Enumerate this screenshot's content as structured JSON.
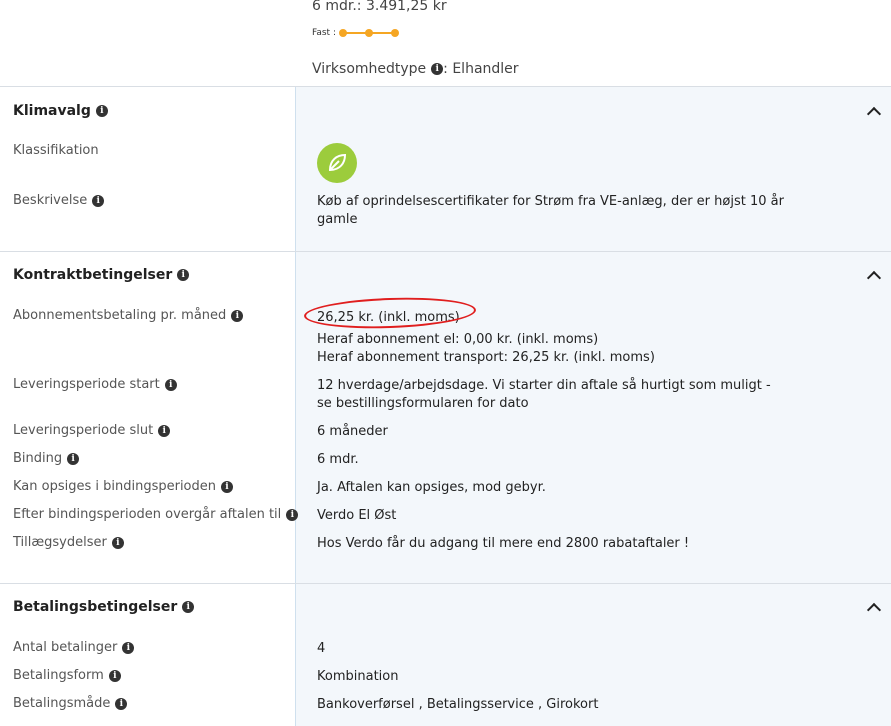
{
  "summary": {
    "price_line": "6 mdr.: 3.491,25 kr",
    "fast_label": "Fast :",
    "business_type_label": "Virksomhedtype",
    "business_type_value": ": Elhandler"
  },
  "sections": {
    "klima": {
      "title": "Klimavalg",
      "classification_label": "Klassifikation",
      "classification_icon": "leaf-icon",
      "description_label": "Beskrivelse",
      "description_value": "Køb af oprindelsescertifikater for Strøm fra VE-anlæg, der er højst 10 år gamle"
    },
    "kontrakt": {
      "title": "Kontraktbetingelser",
      "subscription_label": "Abonnementsbetaling pr. måned",
      "subscription_value": "26,25 kr. (inkl. moms)",
      "subscription_el": "Heraf abonnement el: 0,00 kr. (inkl. moms)",
      "subscription_transport": "Heraf abonnement transport: 26,25 kr. (inkl. moms)",
      "delivery_start_label": "Leveringsperiode start",
      "delivery_start_value": "12 hverdage/arbejdsdage. Vi starter din aftale så hurtigt som muligt - se bestillingsformularen for dato",
      "delivery_end_label": "Leveringsperiode slut",
      "delivery_end_value": "6 måneder",
      "binding_label": "Binding",
      "binding_value": "6 mdr.",
      "cancel_label": "Kan opsiges i bindingsperioden",
      "cancel_value": "Ja. Aftalen kan opsiges, mod gebyr.",
      "after_label": "Efter bindingsperioden overgår aftalen til",
      "after_value": "Verdo El Øst",
      "extras_label": "Tillægsydelser",
      "extras_value": "Hos Verdo får du adgang til mere end 2800 rabataftaler !"
    },
    "betaling": {
      "title": "Betalingsbetingelser",
      "count_label": "Antal betalinger",
      "count_value": "4",
      "form_label": "Betalingsform",
      "form_value": "Kombination",
      "method_label": "Betalingsmåde",
      "method_value": "Bankoverførsel , Betalingsservice , Girokort"
    }
  },
  "colors": {
    "accent_orange": "#f5a623",
    "leaf_green": "#9ccc3c",
    "annotation_red": "#e01e1e",
    "panel_bg": "#f3f7fb"
  },
  "info_icon": "info-circle-icon",
  "collapse_icon": "chevron-up-icon"
}
